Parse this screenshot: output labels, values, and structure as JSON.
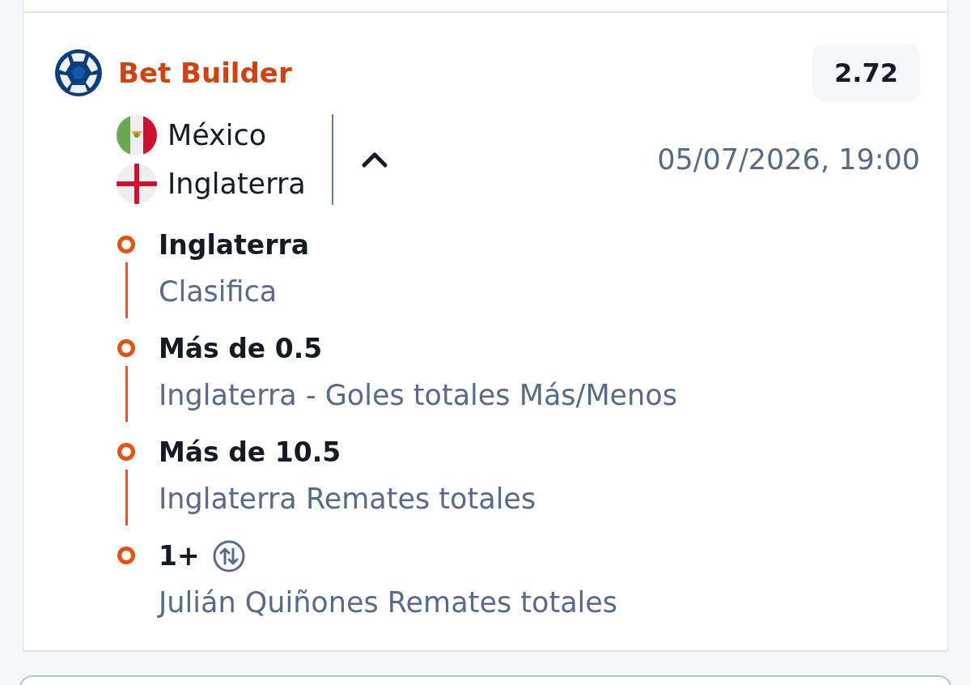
{
  "header": {
    "title": "Bet Builder",
    "odds": "2.72"
  },
  "match": {
    "teams": [
      {
        "name": "México",
        "kind": "mexico"
      },
      {
        "name": "Inglaterra",
        "kind": "england"
      }
    ],
    "expanded": true,
    "datetime": "05/07/2026, 19:00"
  },
  "selections": [
    {
      "pick": "Inglaterra",
      "market": "Clasifica",
      "swap_icon": false
    },
    {
      "pick": "Más de 0.5",
      "market": "Inglaterra - Goles totales Más/Menos",
      "swap_icon": false
    },
    {
      "pick": "Más de 10.5",
      "market": "Inglaterra Remates totales",
      "swap_icon": false
    },
    {
      "pick": "1+",
      "market": "Julián Quiñones Remates totales",
      "swap_icon": true
    }
  ]
}
